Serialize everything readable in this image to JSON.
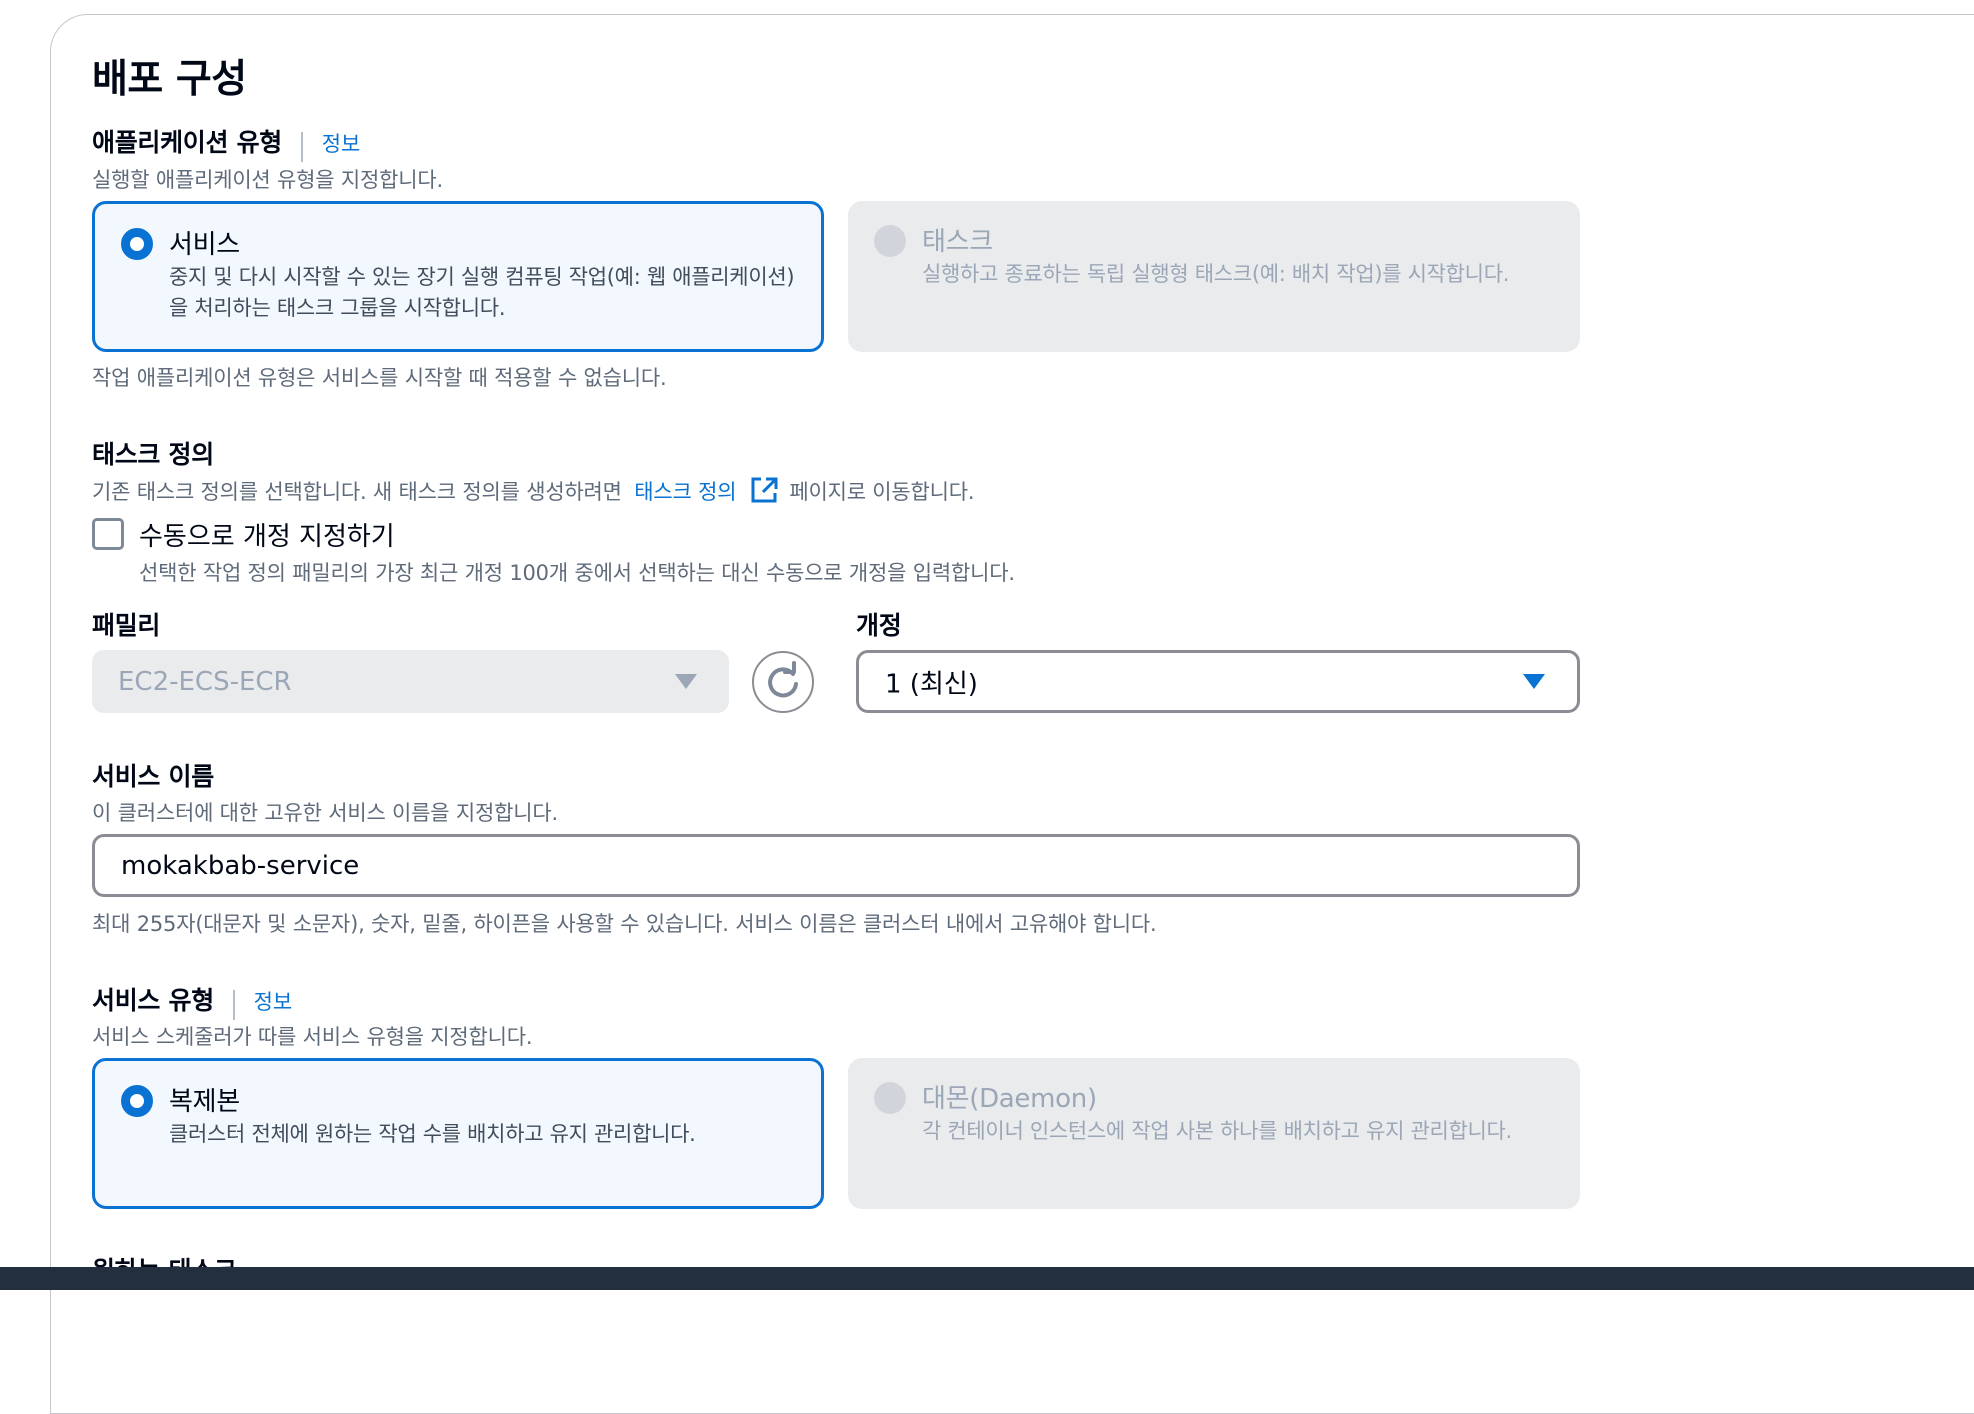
{
  "section": {
    "title": "배포 구성"
  },
  "app_type": {
    "label": "애플리케이션 유형",
    "info_link": "정보",
    "description": "실행할 애플리케이션 유형을 지정합니다.",
    "options": [
      {
        "title": "서비스",
        "description": "중지 및 다시 시작할 수 있는 장기 실행 컴퓨팅 작업(예: 웹 애플리케이션)을 처리하는 태스크 그룹을 시작합니다.",
        "selected": true,
        "disabled": false
      },
      {
        "title": "태스크",
        "description": "실행하고 종료하는 독립 실행형 태스크(예: 배치 작업)를 시작합니다.",
        "selected": false,
        "disabled": true
      }
    ],
    "constraint": "작업 애플리케이션 유형은 서비스를 시작할 때 적용할 수 없습니다."
  },
  "task_definition": {
    "label": "태스크 정의",
    "description_before": "기존 태스크 정의를 선택합니다. 새 태스크 정의를 생성하려면",
    "link_text": "태스크 정의",
    "description_after": "페이지로 이동합니다.",
    "manual_checkbox": {
      "label": "수동으로 개정 지정하기",
      "description": "선택한 작업 정의 패밀리의 가장 최근 개정 100개 중에서 선택하는 대신 수동으로 개정을 입력합니다.",
      "checked": false
    },
    "family": {
      "label": "패밀리",
      "value": "EC2-ECS-ECR",
      "disabled": true
    },
    "revision": {
      "label": "개정",
      "value": "1 (최신)"
    }
  },
  "service_name": {
    "label": "서비스 이름",
    "description": "이 클러스터에 대한 고유한 서비스 이름을 지정합니다.",
    "value": "mokakbab-service",
    "constraint": "최대 255자(대문자 및 소문자), 숫자, 밑줄, 하이픈을 사용할 수 있습니다. 서비스 이름은 클러스터 내에서 고유해야 합니다."
  },
  "service_type": {
    "label": "서비스 유형",
    "info_link": "정보",
    "description": "서비스 스케줄러가 따를 서비스 유형을 지정합니다.",
    "options": [
      {
        "title": "복제본",
        "description": "클러스터 전체에 원하는 작업 수를 배치하고 유지 관리합니다.",
        "selected": true,
        "disabled": false
      },
      {
        "title": "대몬(Daemon)",
        "description": "각 컨테이너 인스턴스에 작업 사본 하나를 배치하고 유지 관리합니다.",
        "selected": false,
        "disabled": true
      }
    ]
  },
  "next_section_label": "원하는 태스크",
  "colors": {
    "accent": "#0972d3",
    "disabled_bg": "#e9ebed",
    "selected_bg": "#f2f8fd",
    "footer_bar": "#232f3e"
  }
}
